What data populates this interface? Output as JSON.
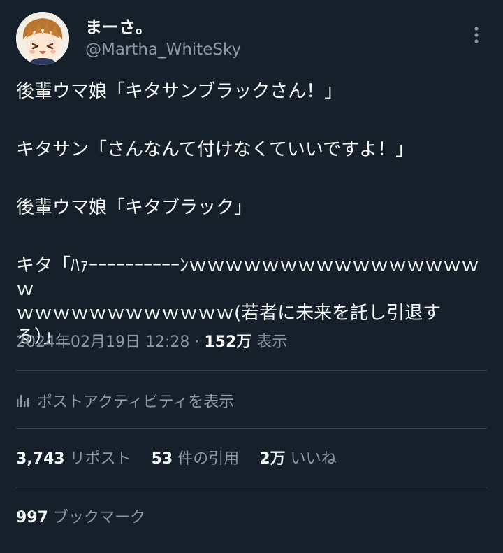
{
  "author": {
    "display_name": "まーさ。",
    "handle": "@Martha_WhiteSky"
  },
  "tweet": {
    "lines": [
      "後輩ウマ娘「キタサンブラックさん！」",
      "キタサン「さんなんて付けなくていいですよ！」",
      "後輩ウマ娘「キタブラック」",
      "キタ「ﾊｧｰｰｰｰｰｰｰｰｰｰﾝｗｗｗｗｗｗｗｗｗｗｗｗｗｗｗｗｗ\nｗｗｗｗｗｗｗｗｗｗｗｗ(若者に未来を託し引退す\nる）」"
    ]
  },
  "meta": {
    "timestamp": "2024年02月19日 12:28",
    "separator": "·",
    "views_count": "152万",
    "views_label": "表示"
  },
  "activity_label": "ポストアクティビティを表示",
  "stats": {
    "reposts_count": "3,743",
    "reposts_label": "リポスト",
    "quotes_count": "53",
    "quotes_label": "件の引用",
    "likes_count": "2万",
    "likes_label": "いいね"
  },
  "bookmarks": {
    "count": "997",
    "label": "ブックマーク"
  },
  "colors": {
    "background": "#15202b",
    "primary_text": "#f7f9f9",
    "secondary_text": "#8b98a5",
    "divider": "#38444d"
  }
}
